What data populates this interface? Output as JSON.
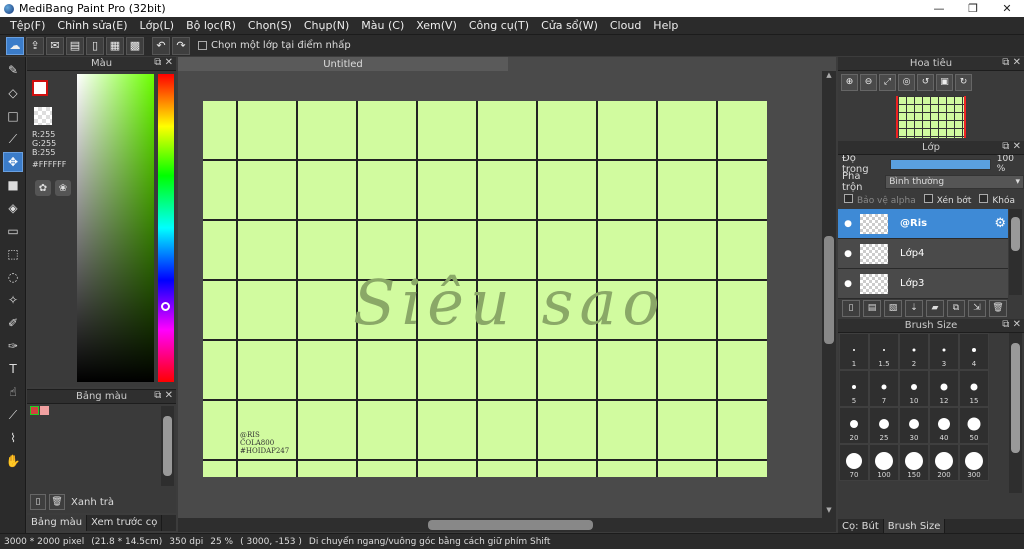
{
  "window": {
    "title": "MediBang Paint Pro (32bit)",
    "minimize": "—",
    "maximize": "❐",
    "close": "✕"
  },
  "menu": [
    "Tệp(F)",
    "Chỉnh sửa(E)",
    "Lớp(L)",
    "Bộ lọc(R)",
    "Chọn(S)",
    "Chụp(N)",
    "Màu (C)",
    "Xem(V)",
    "Công cụ(T)",
    "Cửa sổ(W)",
    "Cloud",
    "Help"
  ],
  "toolbar": {
    "snap_label": "Chọn một lớp tại điểm nhấp"
  },
  "color_panel": {
    "title": "Màu",
    "rgb": "R:255\nG:255\nB:255",
    "hex": "#FFFFFF"
  },
  "palette_panel": {
    "title": "Bảng màu",
    "palette_name": "Xanh trà",
    "tabs": [
      "Bảng màu",
      "Xem trước cọ"
    ]
  },
  "document": {
    "tab_title": "Untitled",
    "art_text": "Siêu sao",
    "watermark": "@RIS\nCOLA800\n#HOIDAP247"
  },
  "navigator": {
    "title": "Hoa tiêu"
  },
  "layers": {
    "title": "Lớp",
    "opacity_label": "Độ trong",
    "opacity_value": "100 %",
    "opacity_fraction": 1.0,
    "blend_label": "Pha trộn",
    "blend_value": "Bình thường",
    "protect_alpha": "Bảo vệ alpha",
    "clipping": "Xén bớt",
    "lock": "Khóa",
    "items": [
      {
        "name": "@Ris",
        "selected": true
      },
      {
        "name": "Lớp4",
        "selected": false
      },
      {
        "name": "Lớp3",
        "selected": false
      }
    ]
  },
  "brush_size": {
    "title": "Brush Size",
    "sizes": [
      "1",
      "1.5",
      "2",
      "3",
      "4",
      "5",
      "7",
      "10",
      "12",
      "15",
      "20",
      "25",
      "30",
      "40",
      "50",
      "70",
      "100",
      "150",
      "200",
      "300"
    ],
    "tabs": [
      "Cọ: Bút",
      "Brush Size"
    ]
  },
  "status": {
    "dimensions": "3000 * 2000 pixel",
    "physical": "(21.8 * 14.5cm)",
    "dpi": "350 dpi",
    "zoom": "25 %",
    "coords": "( 3000, -153 )",
    "hint": "Di chuyển ngang/vuông góc bằng cách giữ phím Shift"
  }
}
